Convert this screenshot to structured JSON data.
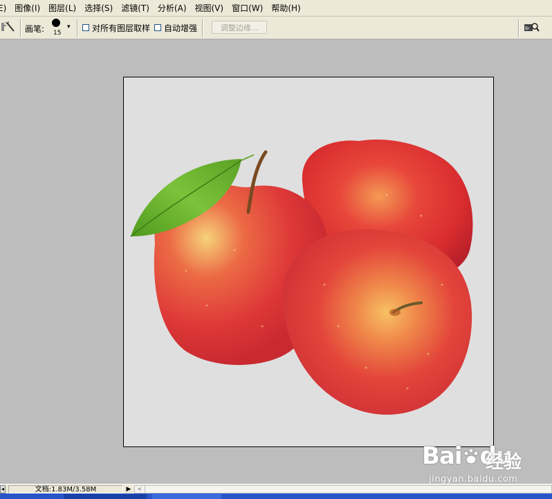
{
  "menu": {
    "items": [
      {
        "label": "E)"
      },
      {
        "label": "图像(I)"
      },
      {
        "label": "图层(L)"
      },
      {
        "label": "选择(S)"
      },
      {
        "label": "滤镜(T)"
      },
      {
        "label": "分析(A)"
      },
      {
        "label": "视图(V)"
      },
      {
        "label": "窗口(W)"
      },
      {
        "label": "帮助(H)"
      }
    ]
  },
  "options": {
    "brush_label": "画笔:",
    "brush_size": "15",
    "brush_arrow": "▾",
    "sample_all_layers": "对所有图层取样",
    "auto_enhance": "自动增强",
    "refine_edge": "调整边缘..."
  },
  "document": {
    "subject_icon": "apples-image"
  },
  "status": {
    "left_arrow": "◂",
    "doc_info": "文档:1.83M/3.58M",
    "right_arrow": "▶",
    "scroll_left": "<"
  },
  "watermark": {
    "logo": "Bai",
    "logo_tail": "du",
    "text": "经验",
    "url": "jingyan.baidu.com"
  }
}
